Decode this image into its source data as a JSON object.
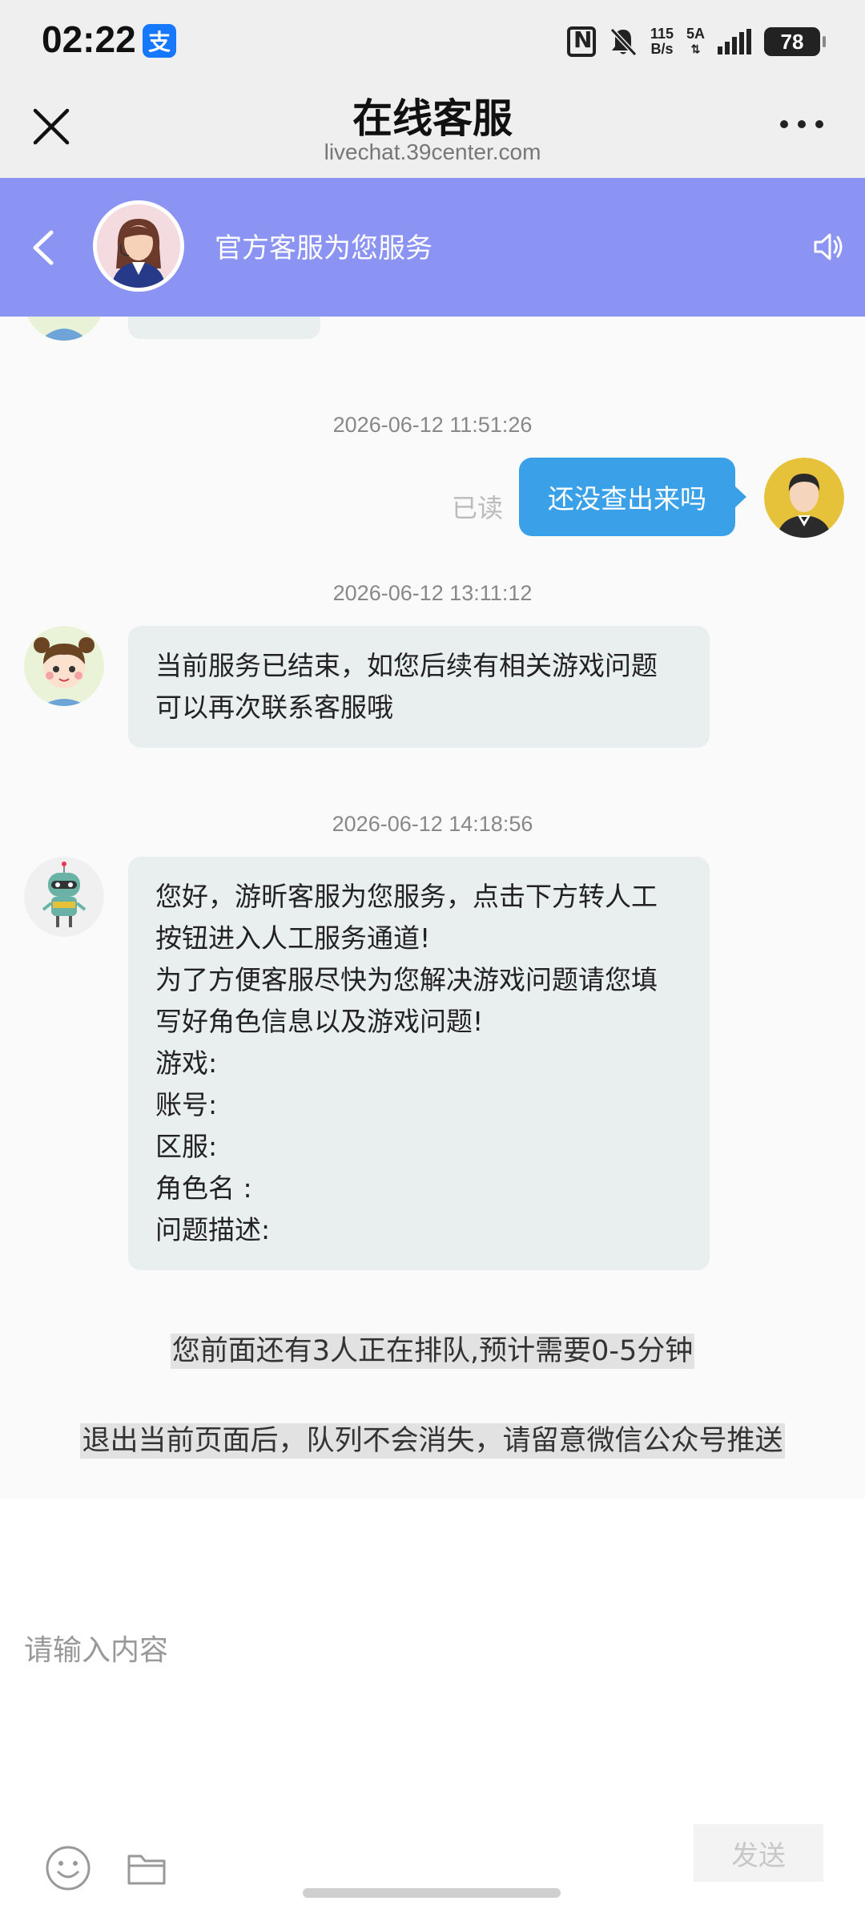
{
  "status_bar": {
    "time": "02:22",
    "alipay_badge": "支",
    "net_speed_value": "115",
    "net_speed_unit": "B/s",
    "network_type": "5A",
    "battery": "78"
  },
  "title_bar": {
    "title": "在线客服",
    "url": "livechat.39center.com"
  },
  "header": {
    "service_text": "官方客服为您服务"
  },
  "messages": [
    {
      "time": "2026-06-12 11:51:26",
      "sender": "user",
      "status": "已读",
      "text": [
        "还没查出来吗"
      ]
    },
    {
      "time": "2026-06-12 13:11:12",
      "sender": "agent",
      "text": [
        "当前服务已结束，如您后续有相关游戏问题",
        "可以再次联系客服哦"
      ]
    },
    {
      "time": "2026-06-12 14:18:56",
      "sender": "bot",
      "text": [
        "您好，游昕客服为您服务，点击下方转人工",
        "按钮进入人工服务通道!",
        "为了方便客服尽快为您解决游戏问题请您填",
        "写好角色信息以及游戏问题!",
        "游戏:",
        "账号:",
        "区服:",
        "角色名 :",
        "问题描述:"
      ]
    }
  ],
  "queue_notice": "您前面还有3人正在排队,预计需要0-5分钟",
  "exit_notice": "退出当前页面后，队列不会消失，请留意微信公众号推送",
  "input": {
    "placeholder": "请输入内容",
    "value": "",
    "send_label": "发送"
  },
  "colors": {
    "header_bg": "#8b93f3",
    "user_bubble": "#3aa0e8",
    "agent_bubble": "#e9eeef"
  }
}
